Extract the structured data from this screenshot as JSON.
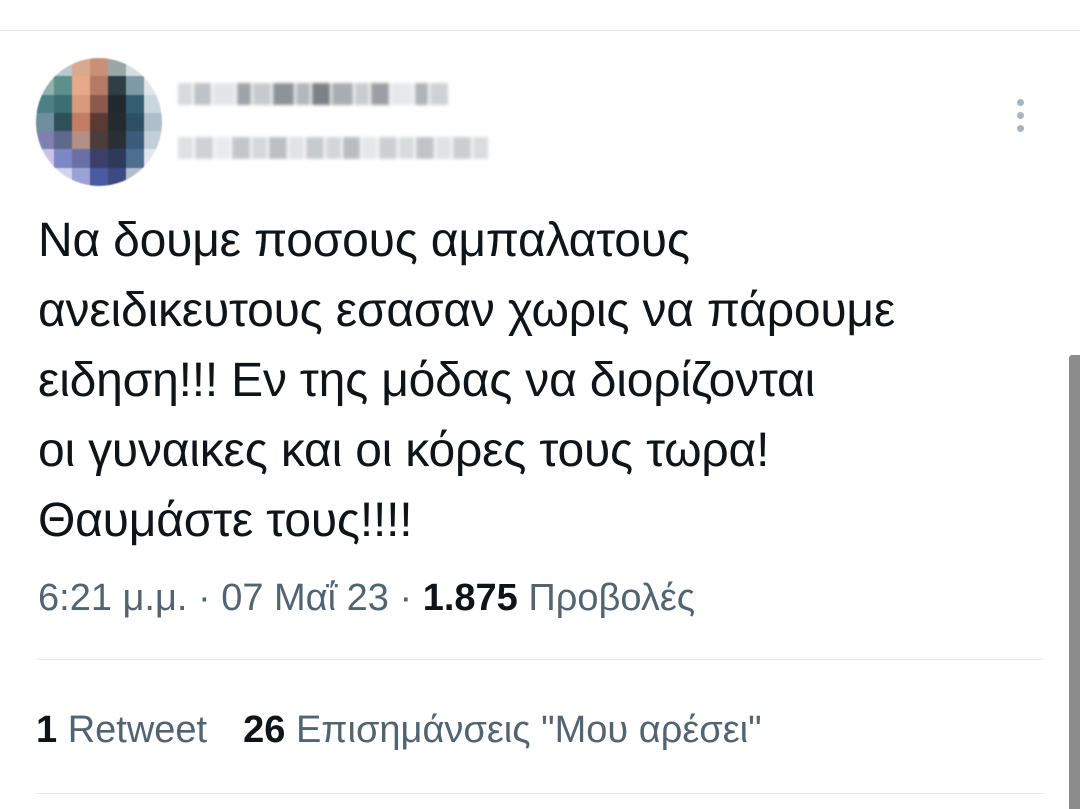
{
  "tweet": {
    "author": {
      "display_name": "",
      "handle": ""
    },
    "text": "Να δουμε ποσους αμπαλατους\nανειδικευτους εσασαν χωρις να πάρουμε\nειδηση!!! Εν της μόδας να διορίζονται\nοι γυναικες και οι κόρες τους τωρα!\nΘαυμάστε τους!!!!",
    "time": "6:21 μ.μ.",
    "date": "07 Μαΐ 23",
    "separator": " · ",
    "views_count": "1.875",
    "views_label": "Προβολές",
    "retweets_count": "1",
    "retweets_label": "Retweet",
    "likes_count": "26",
    "likes_label": "Επισημάνσεις \"Μου αρέσει\""
  },
  "icons": {
    "more": "more-vertical-icon"
  },
  "colors": {
    "text_primary": "#0f1419",
    "text_secondary": "#536471",
    "divider": "#e6e9eb",
    "more_icon": "#aab4bd",
    "scrollbar": "#8c8c8c"
  }
}
